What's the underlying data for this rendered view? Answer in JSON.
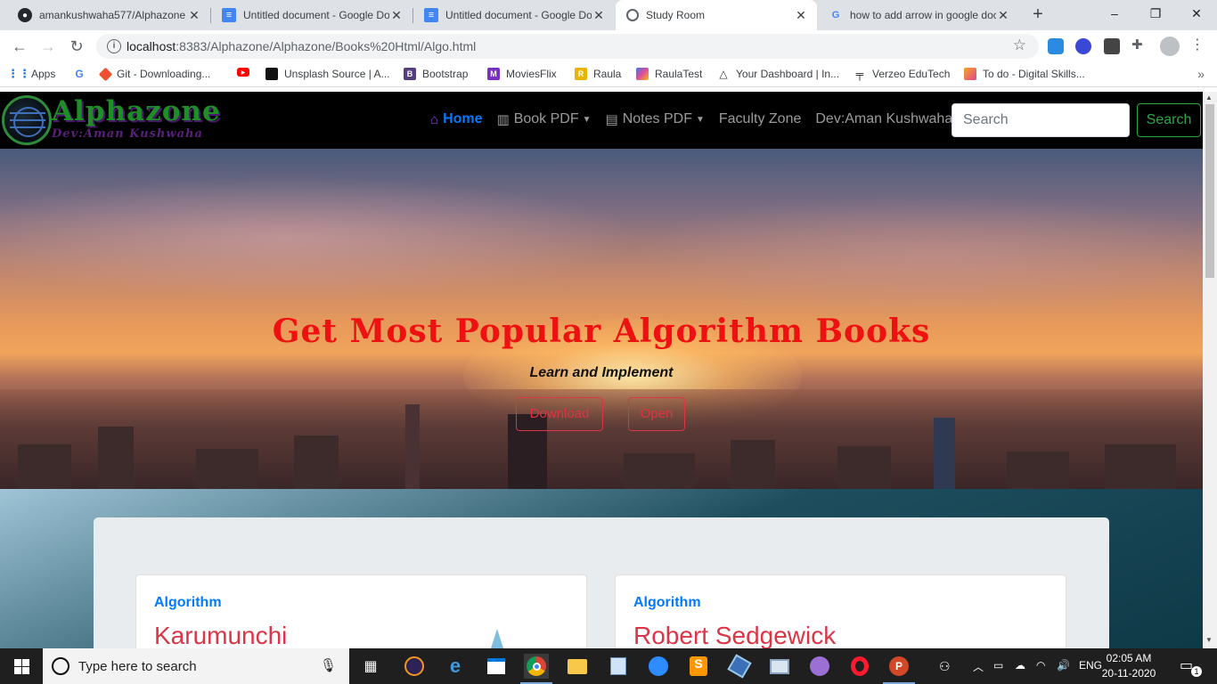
{
  "browser": {
    "tabs": [
      {
        "title": "amankushwaha577/Alphazone",
        "icon": "github-icon",
        "active": false
      },
      {
        "title": "Untitled document - Google Docs",
        "icon": "google-docs-icon",
        "active": false
      },
      {
        "title": "Untitled document - Google Docs",
        "icon": "google-docs-icon",
        "active": false
      },
      {
        "title": "Study Room",
        "icon": "globe-icon",
        "active": true
      },
      {
        "title": "how to add arrow in google docs",
        "icon": "google-icon",
        "active": false
      }
    ],
    "new_tab_label": "+",
    "window_controls": {
      "minimize": "–",
      "maximize": "❐",
      "close": "✕"
    },
    "url": {
      "host": "localhost",
      "rest": ":8383/Alphazone/Alphazone/Books%20Html/Algo.html"
    },
    "bookmarks": [
      {
        "label": "Apps",
        "icon": "apps-grid-icon",
        "color": "#1a73e8"
      },
      {
        "label": "",
        "icon": "google-icon",
        "color": "#4285f4"
      },
      {
        "label": "Git - Downloading...",
        "icon": "git-icon",
        "color": "#f05032"
      },
      {
        "label": "",
        "icon": "youtube-icon",
        "color": "#ff0000"
      },
      {
        "label": "Unsplash Source | A...",
        "icon": "unsplash-icon",
        "color": "#111111"
      },
      {
        "label": "Bootstrap",
        "icon": "bootstrap-icon",
        "color": "#563d7c"
      },
      {
        "label": "MoviesFlix",
        "icon": "moviesflix-icon",
        "color": "#7b2fbf"
      },
      {
        "label": "Raula",
        "icon": "raula-icon",
        "color": "#e8b400"
      },
      {
        "label": "RaulaTest",
        "icon": "raulatest-icon",
        "color": "#3b7de0"
      },
      {
        "label": "Your Dashboard | In...",
        "icon": "dashboard-icon",
        "color": "#333333"
      },
      {
        "label": "Verzeo EduTech",
        "icon": "verzeo-icon",
        "color": "#222222"
      },
      {
        "label": "To do - Digital Skills...",
        "icon": "todo-icon",
        "color": "#e2458f"
      }
    ],
    "bookmarks_more": "»"
  },
  "site": {
    "brand": "Alphazone",
    "brand_sub": "Dev:Aman Kushwaha",
    "nav": [
      {
        "label": "Home",
        "icon": "home-icon",
        "active": true,
        "dropdown": false
      },
      {
        "label": "Book PDF",
        "icon": "book-icon",
        "active": false,
        "dropdown": true
      },
      {
        "label": "Notes PDF",
        "icon": "file-pdf-icon",
        "active": false,
        "dropdown": true
      },
      {
        "label": "Faculty Zone",
        "icon": "",
        "active": false,
        "dropdown": false
      },
      {
        "label": "Dev:Aman Kushwaha",
        "icon": "",
        "active": false,
        "dropdown": false
      }
    ],
    "search": {
      "placeholder": "Search",
      "button": "Search"
    },
    "hero": {
      "title": "Get Most Popular Algorithm Books",
      "subtitle": "Learn and Implement",
      "buttons": [
        "Download",
        "Open"
      ]
    },
    "cards": [
      {
        "category": "Algorithm",
        "author": "Karumunchi"
      },
      {
        "category": "Algorithm",
        "author": "Robert Sedgewick"
      }
    ]
  },
  "taskbar": {
    "search_placeholder": "Type here to search",
    "apps": [
      "task-view-icon",
      "eclipse-icon",
      "edge-icon",
      "store-icon",
      "chrome-icon",
      "file-explorer-icon",
      "notepad-icon",
      "zoom-icon",
      "sublime-icon",
      "virtualbox-icon",
      "screen-icon",
      "github-desktop-icon",
      "opera-icon",
      "powerpoint-icon"
    ],
    "language": "ENG",
    "time": "02:05 AM",
    "date": "20-11-2020",
    "notification_count": "1"
  },
  "colors": {
    "brand_green": "#1e8f26",
    "brand_purple": "#5a1f7a",
    "primary": "#007bff",
    "danger": "#dc3545",
    "success": "#28a745",
    "hero_title": "#ee1111"
  }
}
